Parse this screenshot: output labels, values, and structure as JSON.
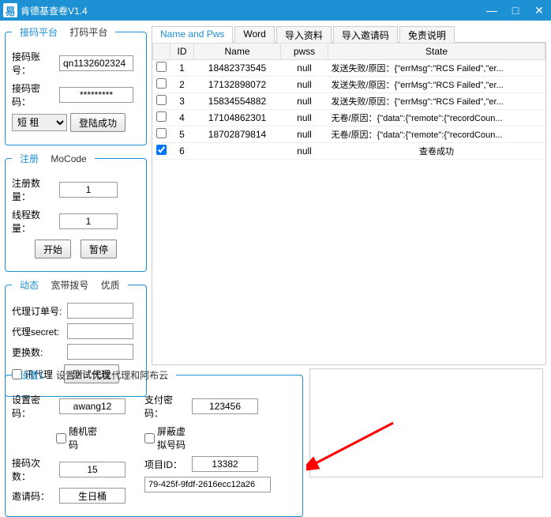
{
  "title": "肯德基查卷V1.4",
  "wbtns": {
    "min": "—",
    "max": "□",
    "close": "✕"
  },
  "left_tabs": {
    "platform": "接码平台",
    "dama": "打码平台"
  },
  "platform": {
    "acct_label": "接码账号：",
    "acct": "qn1132602324",
    "pwd_label": "接码密码：",
    "pwd": "*********",
    "short": "短 租",
    "login": "登陆成功"
  },
  "reg_tabs": {
    "reg": "注册",
    "mo": "MoCode"
  },
  "reg": {
    "num_label": "注册数量：",
    "num": "1",
    "thread_label": "线程数量：",
    "thread": "1",
    "start": "开始",
    "stop": "暂停"
  },
  "dyn_tabs": {
    "dyn": "动态",
    "dial": "宽带拨号",
    "yz": "优质"
  },
  "dyn": {
    "order_label": "代理订单号:",
    "order": "",
    "secret_label": "代理secret:",
    "secret": "",
    "change_label": "更换数:",
    "change": "",
    "xun": "讯代理",
    "test": "测试代理"
  },
  "right_tabs": [
    "Name and Pws",
    "Word",
    "导入资料",
    "导入邀请码",
    "免责说明"
  ],
  "table": {
    "headers": [
      "",
      "ID",
      "Name",
      "pwss",
      "State"
    ],
    "rows": [
      {
        "c": false,
        "id": "1",
        "name": "18482373545",
        "pw": "null",
        "st": "发送失败/原因：{\"errMsg\":\"RCS Failed\",\"er..."
      },
      {
        "c": false,
        "id": "2",
        "name": "17132898072",
        "pw": "null",
        "st": "发送失败/原因：{\"errMsg\":\"RCS Failed\",\"er..."
      },
      {
        "c": false,
        "id": "3",
        "name": "15834554882",
        "pw": "null",
        "st": "发送失败/原因：{\"errMsg\":\"RCS Failed\",\"er..."
      },
      {
        "c": false,
        "id": "4",
        "name": "17104862301",
        "pw": "null",
        "st": "无卷/原因：{\"data\":{\"remote\":{\"recordCoun..."
      },
      {
        "c": false,
        "id": "5",
        "name": "18702879814",
        "pw": "null",
        "st": "无卷/原因：{\"data\":{\"remote\":{\"recordCoun..."
      },
      {
        "c": true,
        "id": "6",
        "name": "",
        "pw": "null",
        "st": "查卷成功"
      }
    ]
  },
  "bottom_tabs": {
    "s1": "设置1",
    "s2": "设置2",
    "wy": "无忧代理和阿布云"
  },
  "settings": {
    "setpwd_label": "设置密码：",
    "setpwd": "awang12",
    "rand": "随机密码",
    "recv_label": "接码次数：",
    "recv": "15",
    "invite_label": "邀请码：",
    "invite": "生日桶",
    "paypwd_label": "支付密码：",
    "paypwd": "123456",
    "mask": "屏蔽虚拟号码",
    "pid_label": "项目ID：",
    "pid": "13382",
    "code": "79-425f-9fdf-2616ecc12a26"
  }
}
